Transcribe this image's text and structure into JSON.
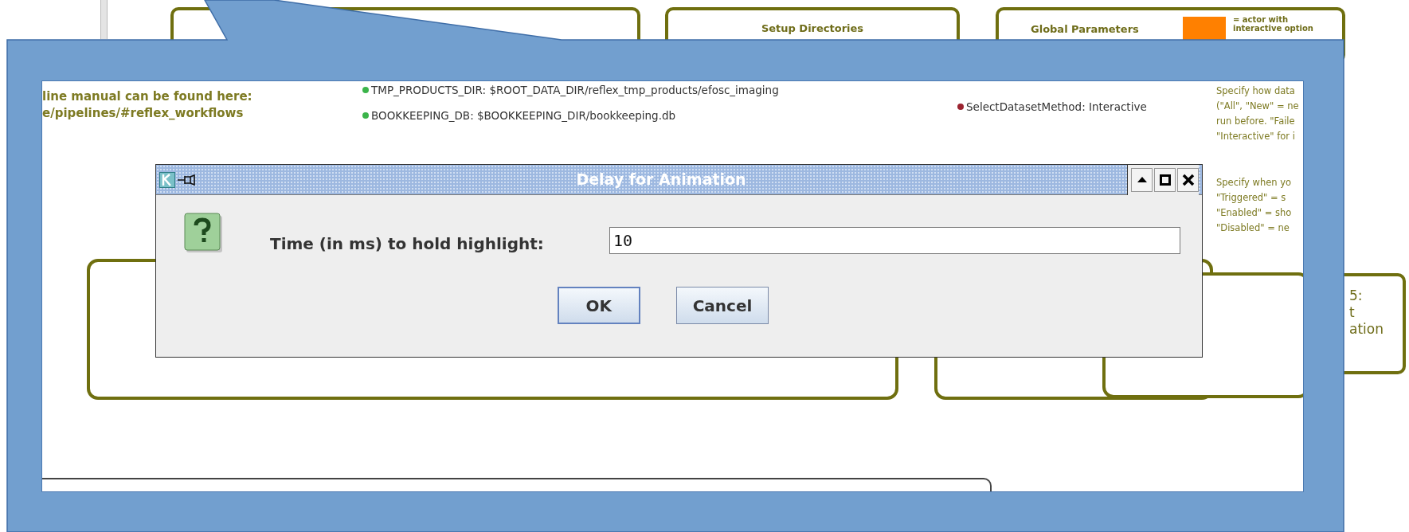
{
  "canvas": {
    "top_boxes": [
      {
        "kind": "blank"
      },
      {
        "kind": "titled",
        "title": "Setup Directories"
      },
      {
        "kind": "legend",
        "title": "Global Parameters",
        "legend": "= actor with interactive option"
      }
    ],
    "right_box": {
      "lines": [
        "5:",
        "t",
        "ation"
      ]
    }
  },
  "detail": {
    "manual_lines": [
      "line manual can be found here:",
      "e/pipelines/#reflex_workflows"
    ],
    "directory_parameters": [
      {
        "text": "TMP_PRODUCTS_DIR: $ROOT_DATA_DIR/reflex_tmp_products/efosc_imaging",
        "color": "#3bb44a"
      },
      {
        "text": "BOOKKEEPING_DB: $BOOKKEEPING_DIR/bookkeeping.db",
        "color": "#3bb44a"
      }
    ],
    "global_parameters": [
      {
        "text": "SelectDatasetMethod: Interactive",
        "color": "#9b2430"
      }
    ],
    "descriptions": [
      {
        "lines": [
          "Specify how data",
          "(\"All\", \"New\" = ne",
          "run before. \"Faile",
          "\"Interactive\" for i"
        ]
      },
      {
        "lines": [
          "Specify when yo",
          "\"Triggered\" = s",
          "\"Enabled\" = sho",
          "\"Disabled\" = ne"
        ]
      }
    ]
  },
  "dialog": {
    "title": "Delay for Animation",
    "prompt": "Time (in ms) to hold highlight:",
    "value": "10",
    "buttons": [
      {
        "label": "OK",
        "default": true
      },
      {
        "label": "Cancel",
        "default": false
      }
    ]
  }
}
